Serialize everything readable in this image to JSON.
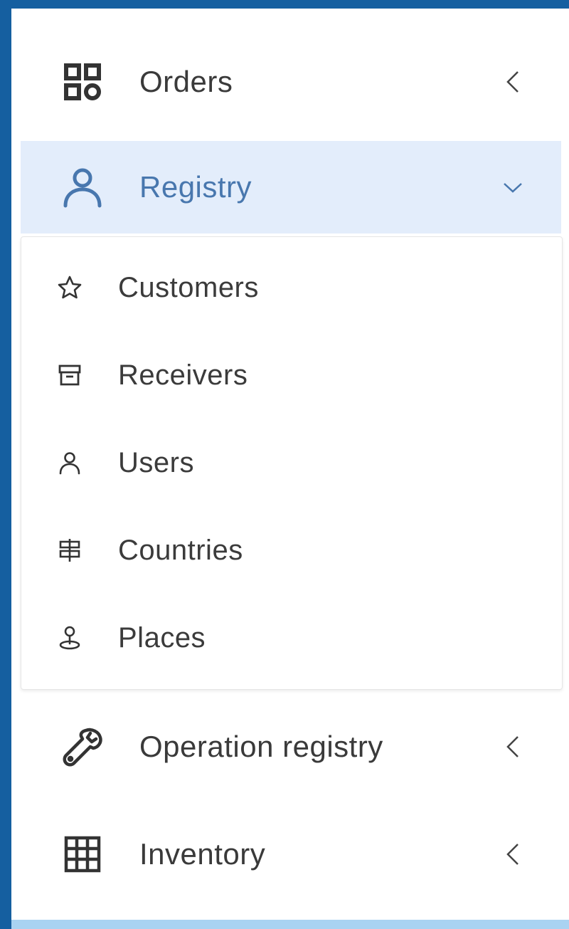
{
  "menu": {
    "orders": {
      "label": "Orders",
      "icon": "grid-apps-icon",
      "state": "collapsed"
    },
    "registry": {
      "label": "Registry",
      "icon": "user-icon",
      "state": "expanded",
      "items": [
        {
          "label": "Customers",
          "icon": "star-icon"
        },
        {
          "label": "Receivers",
          "icon": "archive-box-icon"
        },
        {
          "label": "Users",
          "icon": "user-icon"
        },
        {
          "label": "Countries",
          "icon": "signpost-icon"
        },
        {
          "label": "Places",
          "icon": "map-pin-icon"
        }
      ]
    },
    "operation_registry": {
      "label": "Operation registry",
      "icon": "wrench-icon",
      "state": "collapsed"
    },
    "inventory": {
      "label": "Inventory",
      "icon": "table-grid-icon",
      "state": "collapsed"
    }
  },
  "colors": {
    "frame_border": "#155fa0",
    "active_background": "#e3edfb",
    "active_text": "#4877ae",
    "text": "#3a3a3a"
  }
}
